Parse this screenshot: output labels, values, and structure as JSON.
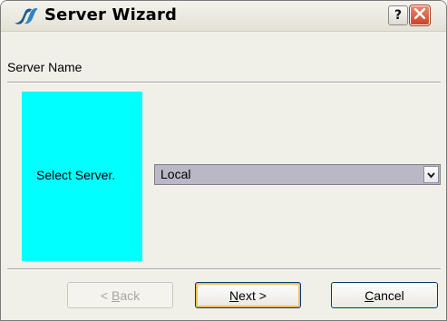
{
  "window": {
    "title": "Server Wizard",
    "help_symbol": "?",
    "icons": {
      "app": "server-wizard-logo-icon",
      "help": "help-icon",
      "close": "close-icon"
    }
  },
  "section": {
    "label": "Server Name"
  },
  "panel": {
    "color": "#00ffff"
  },
  "server_select": {
    "prompt": "Select Server.",
    "value": "Local"
  },
  "buttons": {
    "back": {
      "mnemonic": "B",
      "rest": "ack",
      "prefix": "< ",
      "disabled": true
    },
    "next": {
      "mnemonic": "N",
      "rest": "ext",
      "suffix": " >"
    },
    "cancel": {
      "mnemonic": "C",
      "rest": "ancel"
    }
  },
  "colors": {
    "dialog_bg": "#f1f0e8",
    "accent_cyan": "#00ffff",
    "close_red": "#c8442a",
    "focus_border": "#f4bf58"
  }
}
